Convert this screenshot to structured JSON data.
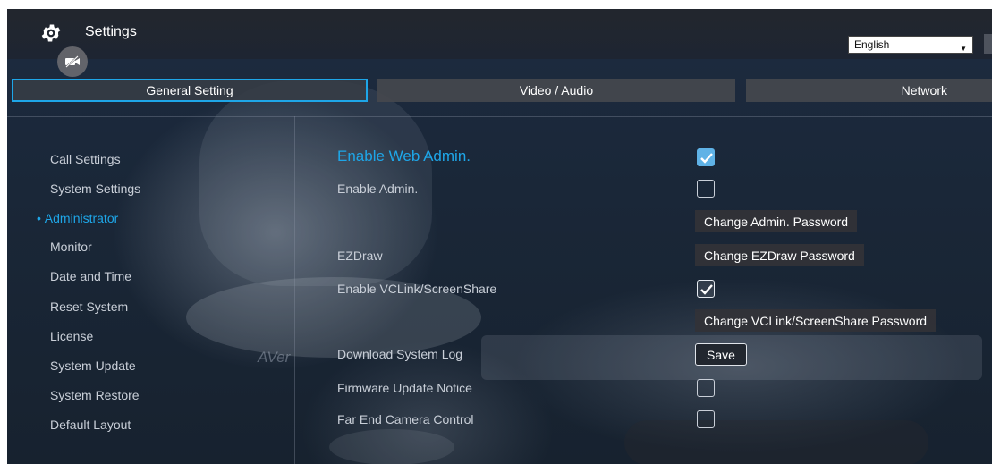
{
  "header": {
    "title": "Settings",
    "icon": "gear-icon",
    "camera_icon": "camera-off-icon",
    "language": {
      "selected": "English"
    }
  },
  "tabs": [
    {
      "label": "General Setting",
      "active": true
    },
    {
      "label": "Video / Audio",
      "active": false
    },
    {
      "label": "Network",
      "active": false
    }
  ],
  "sidebar": {
    "items": [
      {
        "label": "Call Settings",
        "active": false
      },
      {
        "label": "System Settings",
        "active": false
      },
      {
        "label": "Administrator",
        "active": true,
        "bullet": "•"
      },
      {
        "label": "Monitor",
        "active": false
      },
      {
        "label": "Date and Time",
        "active": false
      },
      {
        "label": "Reset System",
        "active": false
      },
      {
        "label": "License",
        "active": false
      },
      {
        "label": "System Update",
        "active": false
      },
      {
        "label": "System Restore",
        "active": false
      },
      {
        "label": "Default Layout",
        "active": false
      }
    ]
  },
  "main": {
    "enable_web_admin": {
      "label": "Enable Web Admin.",
      "checked": true
    },
    "enable_admin": {
      "label": "Enable Admin.",
      "checked": false
    },
    "change_admin_password": {
      "label": "Change Admin. Password"
    },
    "ezdraw": {
      "label": "EZDraw",
      "button": "Change EZDraw Password"
    },
    "enable_vclink": {
      "label": "Enable VCLink/ScreenShare",
      "checked": true
    },
    "change_vclink_password": {
      "label": "Change VCLink/ScreenShare Password"
    },
    "download_log": {
      "label": "Download System Log",
      "button": "Save"
    },
    "firmware_notice": {
      "label": "Firmware Update Notice",
      "checked": false
    },
    "far_end_camera": {
      "label": "Far End Camera Control",
      "checked": false
    }
  },
  "background": {
    "watermark_logo": "AVer"
  },
  "colors": {
    "accent": "#1ea6e8",
    "text": "#c9cfd8",
    "checkbox_checked": "#5fb2e6"
  }
}
